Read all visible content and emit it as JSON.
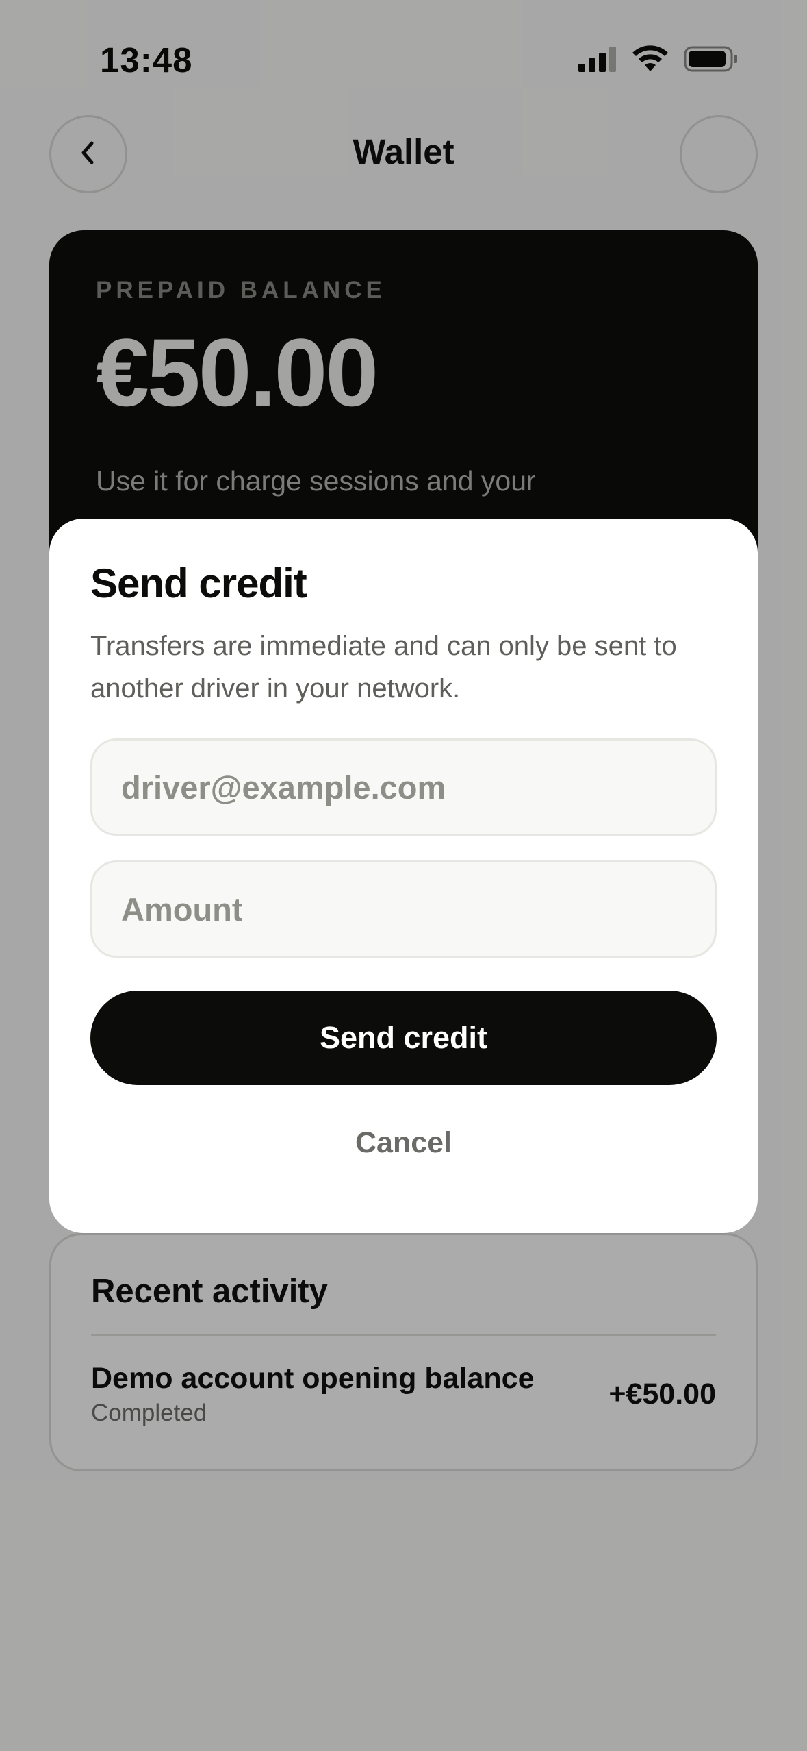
{
  "status_bar": {
    "time": "13:48",
    "icons": [
      "cellular-signal-icon",
      "wifi-icon",
      "battery-icon"
    ]
  },
  "header": {
    "title": "Wallet",
    "back_icon": "chevron-left-icon"
  },
  "balance_card": {
    "eyebrow": "PREPAID BALANCE",
    "amount": "€50.00",
    "description": "Use it for charge sessions and your"
  },
  "sheet": {
    "title": "Send credit",
    "description": "Transfers are immediate and can only be sent to another driver in your network.",
    "email_placeholder": "driver@example.com",
    "amount_placeholder": "Amount",
    "send_label": "Send credit",
    "cancel_label": "Cancel"
  },
  "activity": {
    "title": "Recent activity",
    "items": [
      {
        "name": "Demo account opening balance",
        "status": "Completed",
        "amount": "+€50.00"
      }
    ]
  },
  "colors": {
    "primary": "#0c0c0a",
    "card_dark": "#0e0f0b",
    "scrim": "#a4a4a3",
    "muted_text": "#6e6e6a"
  }
}
